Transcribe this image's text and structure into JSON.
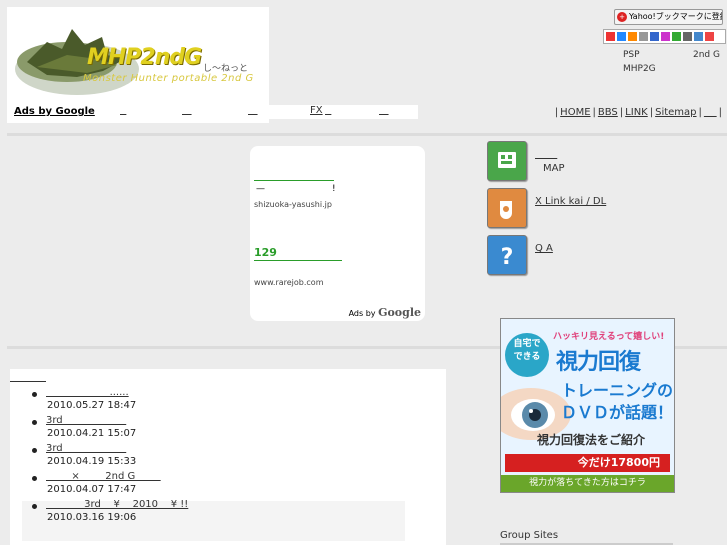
{
  "header": {
    "logo_text": "MHP2ndG",
    "logo_suffix": "し〜ねっと",
    "logo_sub": "Monster Hunter portable 2nd G",
    "ads_label": "Ads by Google",
    "ads_links": [
      "",
      "",
      "",
      "FX",
      ""
    ],
    "topnav": [
      {
        "label": "HOME"
      },
      {
        "label": "BBS"
      },
      {
        "label": "LINK"
      },
      {
        "label": "Sitemap"
      },
      {
        "label": ""
      }
    ],
    "yahoo_bookmark": "Yahoo!ブックマークに登録",
    "psp": "PSP",
    "second_g": "2nd G",
    "mhp2g": "MHP2G"
  },
  "adbox": {
    "title1": "",
    "desc1": "—",
    "bang": "!",
    "url1": "shizuoka-yasushi.jp",
    "title2": "129",
    "url2": "www.rarejob.com",
    "ads_by": "Ads by",
    "google": "Google"
  },
  "sidenav": [
    {
      "line1": "",
      "line2": "MAP",
      "icon": "map-icon"
    },
    {
      "line1": "X Link kai / DL",
      "line2": "",
      "icon": "link-icon"
    },
    {
      "line1": "Q A",
      "line2": "",
      "icon": "question-icon"
    }
  ],
  "banner": {
    "bubble": "自宅で\nできる",
    "tag": "ハッキリ見えるって嬉しい!",
    "h1": "視力回復",
    "h2": "トレーニングの",
    "h3": "ＤＶＤが話題！",
    "h4": "視力回復法をご紹介",
    "price": "今だけ17800円",
    "foot": "視力が落ちてきた方はコチラ"
  },
  "group_sites": "Group Sites",
  "recent": {
    "title": "",
    "items": [
      {
        "title": "                    ......",
        "date": "2010.05.27 18:47"
      },
      {
        "title": "3rd                    ",
        "date": "2010.04.21 15:07"
      },
      {
        "title": "3rd                    ",
        "date": "2010.04.19 15:33"
      },
      {
        "title": "        ×        2nd G        ",
        "date": "2010.04.07 17:47"
      },
      {
        "title": "            3rd    ¥    2010    ¥ !!",
        "date": "2010.03.16 19:06"
      }
    ]
  },
  "colors": {
    "background": "#ececec",
    "ad_green": "#2a9d2a",
    "banner_blue": "#1a7ad0",
    "price_red": "#d62020"
  }
}
